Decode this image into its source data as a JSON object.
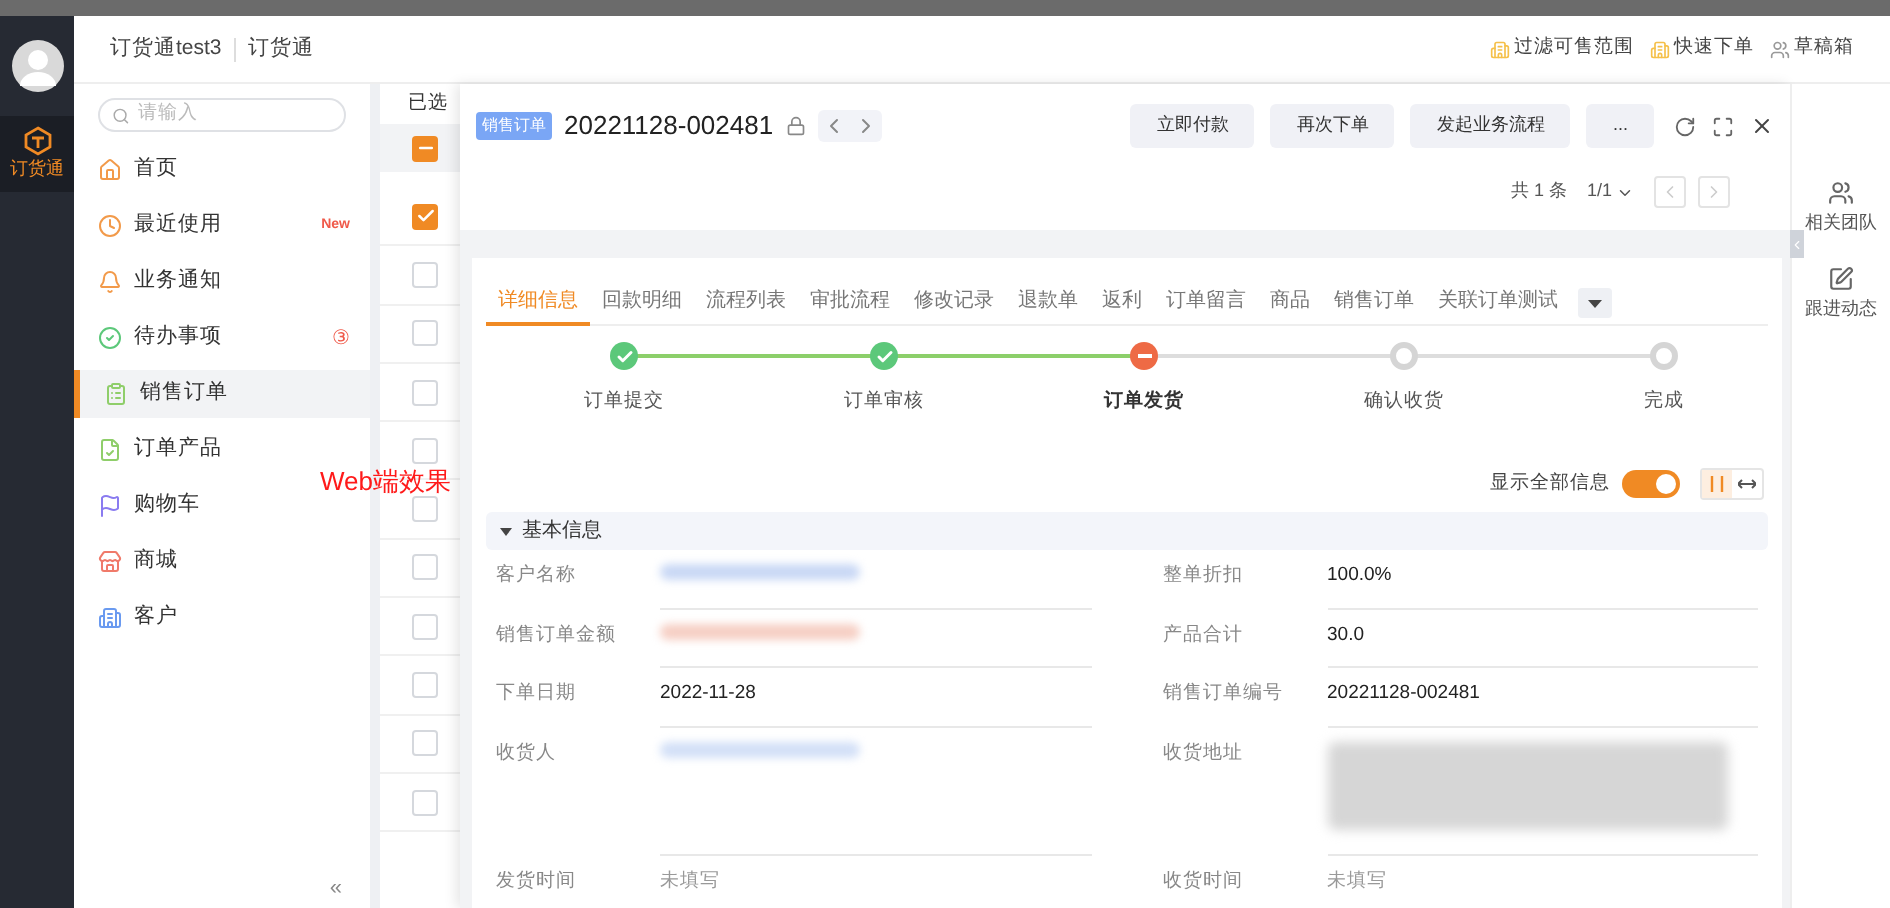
{
  "app_rail": {
    "label": "订货通",
    "selected": true
  },
  "header": {
    "breadcrumb": [
      "订货通test3",
      "订货通"
    ],
    "actions": [
      "过滤可售范围",
      "快速下单",
      "草稿箱"
    ]
  },
  "sidebar": {
    "search": {
      "placeholder": "请输入"
    },
    "items": [
      {
        "label": "首页",
        "selected": false
      },
      {
        "label": "最近使用",
        "selected": false,
        "badge": {
          "kind": "new",
          "text": "New"
        }
      },
      {
        "label": "业务通知",
        "selected": false
      },
      {
        "label": "待办事项",
        "selected": false,
        "badge": {
          "kind": "count",
          "text": "③"
        }
      },
      {
        "label": "销售订单",
        "selected": true
      },
      {
        "label": "订单产品",
        "selected": false
      },
      {
        "label": "购物车",
        "selected": false
      },
      {
        "label": "商城",
        "selected": false
      },
      {
        "label": "客户",
        "selected": false
      }
    ],
    "collapse": "«"
  },
  "annotation": "Web端效果",
  "list": {
    "header": "已选",
    "select_all": {
      "checked": true,
      "partial": true
    },
    "rows": [
      {
        "checked": true
      },
      {
        "checked": false
      },
      {
        "checked": false
      },
      {
        "checked": false
      },
      {
        "checked": false
      },
      {
        "checked": false
      },
      {
        "checked": false
      },
      {
        "checked": false
      },
      {
        "checked": false
      },
      {
        "checked": false
      },
      {
        "checked": false
      }
    ]
  },
  "detail": {
    "tag": "销售订单",
    "number": "20221128-002481",
    "buttons": [
      "立即付款",
      "再次下单",
      "发起业务流程",
      "..."
    ],
    "pager": {
      "total": "共 1 条",
      "page": "1/1"
    },
    "tabs": [
      {
        "label": "详细信息",
        "selected": true
      },
      {
        "label": "回款明细",
        "selected": false
      },
      {
        "label": "流程列表",
        "selected": false
      },
      {
        "label": "审批流程",
        "selected": false
      },
      {
        "label": "修改记录",
        "selected": false
      },
      {
        "label": "退款单",
        "selected": false
      },
      {
        "label": "返利",
        "selected": false
      },
      {
        "label": "订单留言",
        "selected": false
      },
      {
        "label": "商品",
        "selected": false
      },
      {
        "label": "销售订单",
        "selected": false
      },
      {
        "label": "关联订单测试",
        "selected": false
      }
    ],
    "steps": [
      {
        "label": "订单提交",
        "done": true,
        "current": false
      },
      {
        "label": "订单审核",
        "done": true,
        "current": false
      },
      {
        "label": "订单发货",
        "done": false,
        "current": true
      },
      {
        "label": "确认收货",
        "done": false,
        "current": false
      },
      {
        "label": "完成",
        "done": false,
        "current": false
      }
    ],
    "show_all": {
      "label": "显示全部信息",
      "on": true
    },
    "section": {
      "title": "基本信息",
      "expanded": true
    },
    "fields": [
      {
        "label": "客户名称",
        "kind": "redacted",
        "color": "#c9d8f5"
      },
      {
        "label": "整单折扣",
        "kind": "text",
        "value": "100.0%"
      },
      {
        "label": "销售订单金额",
        "kind": "redacted",
        "color": "#f6cfc4"
      },
      {
        "label": "产品合计",
        "kind": "text",
        "value": "30.0"
      },
      {
        "label": "下单日期",
        "kind": "text",
        "value": "2022-11-28"
      },
      {
        "label": "销售订单编号",
        "kind": "text",
        "value": "20221128-002481"
      },
      {
        "label": "收货人",
        "kind": "redacted",
        "color": "#d3e0f7"
      },
      {
        "label": "收货地址",
        "kind": "redacted_tall",
        "color": "#d6d6d6"
      },
      {
        "label": "发货时间",
        "kind": "empty",
        "value": "未填写"
      },
      {
        "label": "收货时间",
        "kind": "empty",
        "value": "未填写"
      }
    ]
  },
  "right_panel": [
    {
      "label": "相关团队"
    },
    {
      "label": "跟进动态"
    }
  ]
}
